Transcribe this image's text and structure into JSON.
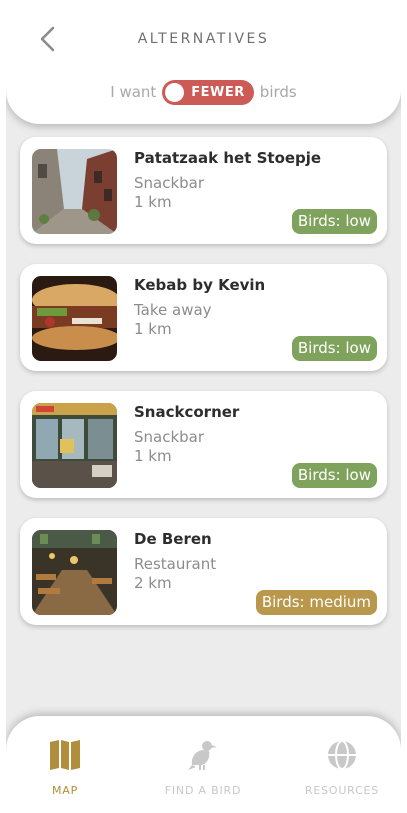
{
  "header": {
    "title": "ALTERNATIVES",
    "toggle_prefix": "I want",
    "toggle_value": "FEWER",
    "toggle_suffix": "birds"
  },
  "places": [
    {
      "name": "Patatzaak het Stoepje",
      "type": "Snackbar",
      "distance": "1 km",
      "birds": "Birds: low",
      "birds_level": "low",
      "photo": "street-photo"
    },
    {
      "name": "Kebab by Kevin",
      "type": "Take away",
      "distance": "1 km",
      "birds": "Birds: low",
      "birds_level": "low",
      "photo": "kebab-photo"
    },
    {
      "name": "Snackcorner",
      "type": "Snackbar",
      "distance": "1 km",
      "birds": "Birds: low",
      "birds_level": "low",
      "photo": "snackbar-photo"
    },
    {
      "name": "De Beren",
      "type": "Restaurant",
      "distance": "2 km",
      "birds": "Birds: medium",
      "birds_level": "medium",
      "photo": "restaurant-photo"
    }
  ],
  "nav": {
    "map": "MAP",
    "find_bird": "FIND A BIRD",
    "resources": "RESOURCES"
  },
  "colors": {
    "toggle_red": "#cc5b55",
    "birds_low": "#7fa35d",
    "birds_medium": "#b9974b",
    "nav_active": "#b18e3c",
    "nav_inactive": "#c8c8c8"
  }
}
